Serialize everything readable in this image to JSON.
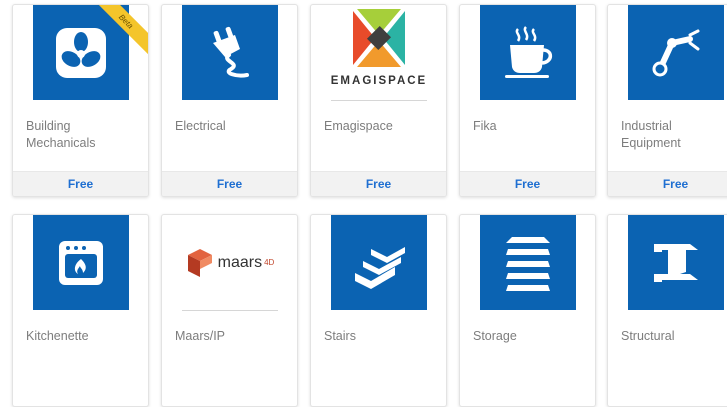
{
  "apps": [
    {
      "name": "Building Mechanicals",
      "price": "Free",
      "icon": "fan-icon",
      "badge": "Beta"
    },
    {
      "name": "Electrical",
      "price": "Free",
      "icon": "plug-icon"
    },
    {
      "name": "Emagispace",
      "price": "Free",
      "icon": "emagispace-logo",
      "logo_text": "EMAGISPACE"
    },
    {
      "name": "Fika",
      "price": "Free",
      "icon": "coffee-cup-icon"
    },
    {
      "name": "Industrial Equipment",
      "price": "Free",
      "icon": "robot-arm-icon"
    },
    {
      "name": "Kitchenette",
      "icon": "oven-icon"
    },
    {
      "name": "Maars/IP",
      "icon": "maars-logo",
      "logo_text": "maars",
      "logo_suffix": "4D"
    },
    {
      "name": "Stairs",
      "icon": "stairs-icon"
    },
    {
      "name": "Storage",
      "icon": "shelves-icon"
    },
    {
      "name": "Structural",
      "icon": "i-beam-icon"
    }
  ],
  "colors": {
    "tile_blue": "#0b63b2",
    "price_blue": "#1f6fd1",
    "beta_ribbon": "#f4c52b"
  }
}
